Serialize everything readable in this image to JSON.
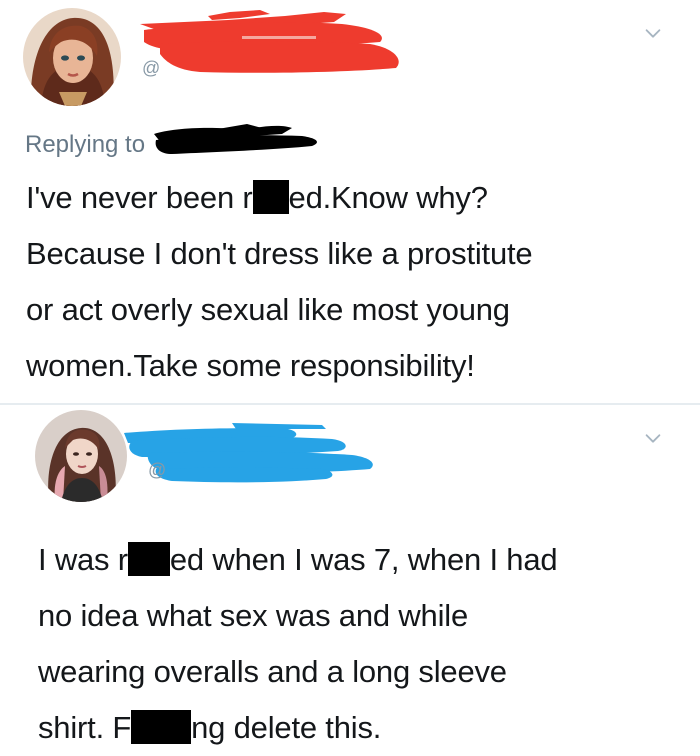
{
  "tweets": [
    {
      "handle_prefix": "@",
      "replying_to_label": "Replying to",
      "text_lines": [
        {
          "before": "I've never been r",
          "after": "ed.Know why?"
        },
        {
          "before": "Because I don't dress like a prostitute",
          "after": ""
        },
        {
          "before": "or act overly sexual like most young",
          "after": ""
        },
        {
          "before": "women.Take some responsibility!",
          "after": ""
        }
      ],
      "redaction_color": "#ee3b2e"
    },
    {
      "handle_prefix": "@",
      "text_lines": [
        {
          "before": "I was r",
          "after": "ed when I was 7, when I had"
        },
        {
          "before": "no idea what sex was and while",
          "after": ""
        },
        {
          "before": "wearing overalls and a long sleeve",
          "after": ""
        },
        {
          "before": "shirt. F",
          "after": "ng delete this."
        }
      ],
      "redaction_color": "#27a3e6"
    }
  ],
  "icons": {
    "menu": "chevron-down-icon"
  },
  "colors": {
    "text": "#14171a",
    "muted": "#657786",
    "separator": "#e6ecf0",
    "censor_bar": "#000000"
  }
}
